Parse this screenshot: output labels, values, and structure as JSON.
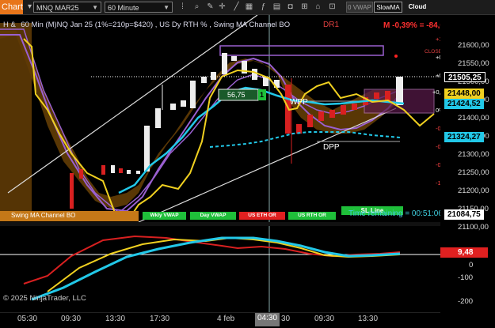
{
  "toolbar": {
    "tab_label": "Chart",
    "instrument": "MNQ MAR25",
    "interval": "60 Minute",
    "buttons": [
      "0 VWAP",
      "SlowMA",
      "Cloud"
    ]
  },
  "chart": {
    "title": "H &   60 Min  (M)NQ Jan 25 (1%=210p=$420) , US Dy RTH % , Swing MA Channel BO",
    "dr_label": "DR1",
    "pnl": "M -0,39% = -84,00",
    "box_value": "56,75",
    "box_count": "1",
    "wpp_label": "WPP",
    "dpp_label": "DPP",
    "close_label": "CLOSE",
    "sl_line": "SL Line",
    "time_remaining": "Time remaining = 00:51:06",
    "copyright": "© 2025 NinjaTrader, LLC",
    "swing_label": "Swing MA Channel BO"
  },
  "indicator_buttons": [
    "Wkly VWAP",
    "Day VWAP",
    "US ETH OR",
    "US RTH OR"
  ],
  "price_axis": [
    "21600,00",
    "21550,00",
    "21500,00",
    "21450,00",
    "21400,00",
    "21350,00",
    "21300,00",
    "21250,00",
    "21200,00",
    "21150,00",
    "21100,00"
  ],
  "price_tags": {
    "current": "21505,25",
    "level1": "21448,00",
    "level2": "21424,52",
    "level3": "21324,27",
    "level4": "21084,75"
  },
  "pct_levels": [
    "+1,0%",
    "+0,75",
    "+0,5%",
    "+0,25",
    "0%",
    "-0,25%",
    "-0,5%",
    "-0,75%",
    "-1,0%"
  ],
  "osc_axis": {
    "labels": [
      "0",
      "-100",
      "-200"
    ],
    "tag": "9,48"
  },
  "time_axis": [
    "05:30",
    "09:30",
    "13:30",
    "17:30",
    "4 feb",
    "04:30",
    "30",
    "09:30",
    "13:30"
  ],
  "colors": {
    "accent": "#e8751a",
    "sl_green": "#1fbf3a",
    "red_btn": "#e02020",
    "cyan": "#22c8e8",
    "yellow": "#f0d020",
    "purple": "#9a60d0"
  }
}
